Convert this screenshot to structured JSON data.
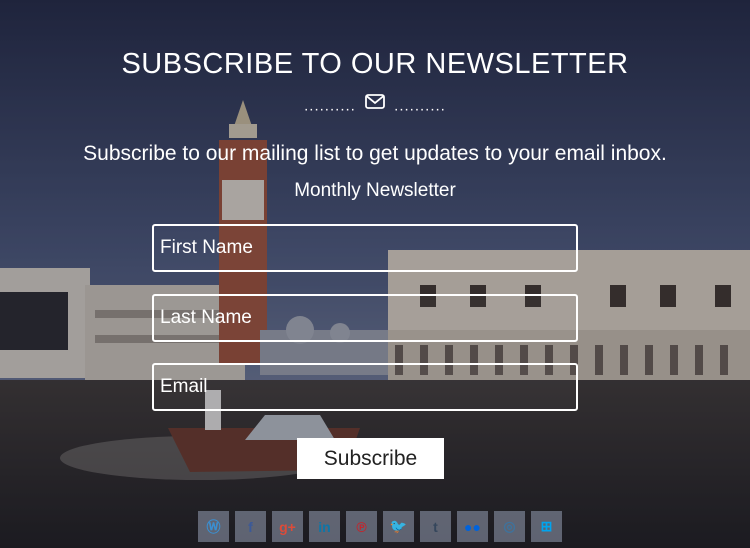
{
  "header": {
    "title": "SUBSCRIBE TO OUR NEWSLETTER",
    "divider_left": "..........",
    "divider_right": "..........",
    "divider_icon": "envelope-icon"
  },
  "tagline": "Subscribe to our mailing list to get updates to your email inbox.",
  "subhead": "Monthly Newsletter",
  "form": {
    "first_name_placeholder": "First Name",
    "last_name_placeholder": "Last Name",
    "email_placeholder": "Email",
    "submit_label": "Subscribe"
  },
  "social": [
    {
      "name": "wordpress-icon",
      "glyph": "Ⓦ",
      "color": "#3b8fd1"
    },
    {
      "name": "facebook-icon",
      "glyph": "f",
      "color": "#3b5998"
    },
    {
      "name": "google-plus-icon",
      "glyph": "g+",
      "color": "#dd4b39"
    },
    {
      "name": "linkedin-icon",
      "glyph": "in",
      "color": "#0e76a8"
    },
    {
      "name": "pinterest-icon",
      "glyph": "℗",
      "color": "#cb2027"
    },
    {
      "name": "twitter-icon",
      "glyph": "🐦",
      "color": "#1da1f2"
    },
    {
      "name": "tumblr-icon",
      "glyph": "t",
      "color": "#35465c"
    },
    {
      "name": "flickr-icon",
      "glyph": "●●",
      "color": "#0063dc"
    },
    {
      "name": "instagram-icon",
      "glyph": "◎",
      "color": "#3f729b"
    },
    {
      "name": "windows-icon",
      "glyph": "⊞",
      "color": "#00a4ef"
    }
  ]
}
